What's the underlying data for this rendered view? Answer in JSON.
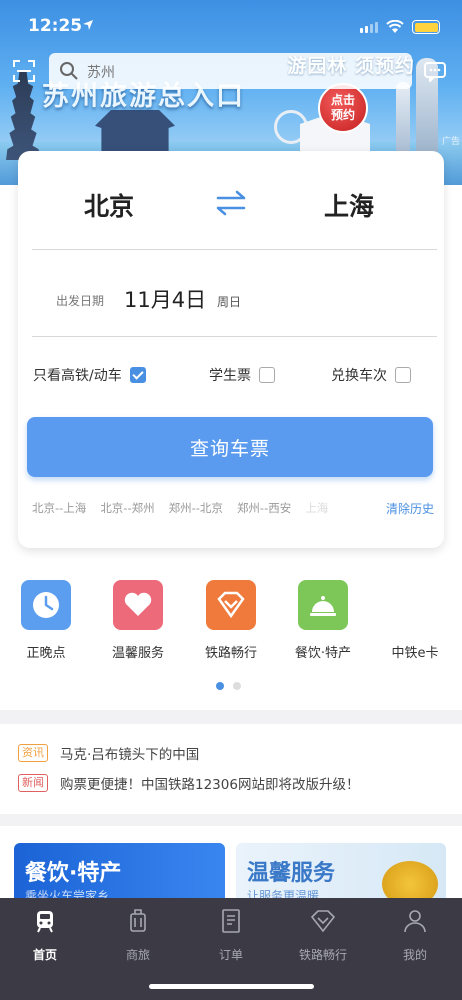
{
  "status_bar": {
    "time": "12:25"
  },
  "banner": {
    "search_placeholder": "苏州",
    "title": "苏州旅游总入口",
    "slogan": "游园林 须预约",
    "badge_line1": "点击",
    "badge_line2": "预约",
    "ad_tag": "广告"
  },
  "booking": {
    "from_city": "北京",
    "to_city": "上海",
    "date_label": "出发日期",
    "date": "11月4日",
    "weekday": "周日",
    "options": [
      {
        "label": "只看高铁/动车",
        "checked": true
      },
      {
        "label": "学生票",
        "checked": false
      },
      {
        "label": "兑换车次",
        "checked": false
      }
    ],
    "query_button": "查询车票",
    "history": [
      "北京--上海",
      "北京--郑州",
      "郑州--北京",
      "郑州--西安",
      "上海"
    ],
    "clear_history": "清除历史"
  },
  "shortcuts": [
    {
      "label": "正晚点",
      "icon": "clock-icon",
      "color": "#5b9ef0"
    },
    {
      "label": "温馨服务",
      "icon": "heart-icon",
      "color": "#ec6a7a"
    },
    {
      "label": "铁路畅行",
      "icon": "diamond-icon",
      "color": "#f07a3c"
    },
    {
      "label": "餐饮·特产",
      "icon": "bell-icon",
      "color": "#7dc758"
    },
    {
      "label": "中铁e卡",
      "icon": "card-icon",
      "color": "#ffffff"
    }
  ],
  "carousel": {
    "pages": 2,
    "active": 1
  },
  "news": [
    {
      "tag": "资讯",
      "tag_color": "#f0a040",
      "text": "马克·吕布镜头下的中国"
    },
    {
      "tag": "新闻",
      "tag_color": "#e06060",
      "text": "购票更便捷！中国铁路12306网站即将改版升级！"
    }
  ],
  "promo": [
    {
      "title": "餐饮·特产",
      "subtitle": "乘坐火车尝家乡",
      "text_color": "#ffffff"
    },
    {
      "title": "温馨服务",
      "subtitle": "让服务更温暖",
      "text_color": "#3a78c8"
    }
  ],
  "tabs": [
    {
      "label": "首页",
      "icon": "train-icon",
      "active": true
    },
    {
      "label": "商旅",
      "icon": "luggage-icon",
      "active": false
    },
    {
      "label": "订单",
      "icon": "order-list-icon",
      "active": false
    },
    {
      "label": "铁路畅行",
      "icon": "diamond-icon",
      "active": false
    },
    {
      "label": "我的",
      "icon": "person-icon",
      "active": false
    }
  ]
}
